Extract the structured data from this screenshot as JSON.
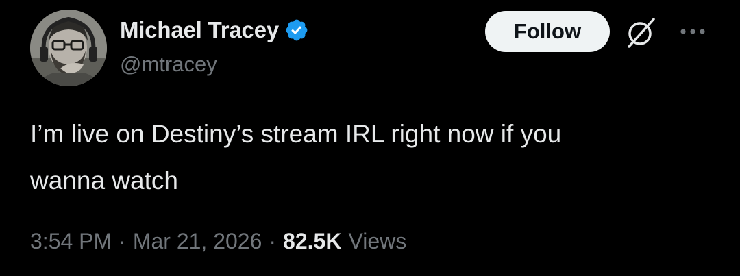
{
  "author": {
    "display_name": "Michael Tracey",
    "handle": "@mtracey",
    "verified": true,
    "badge_color": "#1d9bf0"
  },
  "actions": {
    "follow_label": "Follow",
    "grok_icon": "grok-icon",
    "more_icon": "more-icon"
  },
  "tweet": {
    "text": "I’m live on Destiny’s stream IRL right now if you\nwanna watch"
  },
  "meta": {
    "time": "3:54 PM",
    "separator": "·",
    "date": "Mar 21, 2026",
    "views_count": "82.5K",
    "views_label": "Views"
  },
  "colors": {
    "background": "#000000",
    "primary_text": "#e7e9ea",
    "secondary_text": "#71767b",
    "follow_bg": "#eff3f4",
    "follow_text": "#0f1419"
  }
}
